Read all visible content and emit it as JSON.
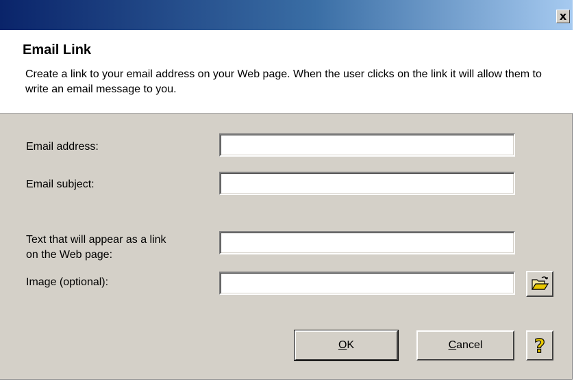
{
  "window": {
    "title": "",
    "close_glyph": "x"
  },
  "header": {
    "heading": "Email Link",
    "description": "Create a link to your email address on your Web page.  When the user clicks on the link it will allow them to write an email message to you."
  },
  "form": {
    "email_address": {
      "label": "Email address:",
      "value": ""
    },
    "email_subject": {
      "label": "Email subject:",
      "value": ""
    },
    "link_text": {
      "label_line1": "Text that will appear as a link",
      "label_line2": "on the Web page:",
      "value": ""
    },
    "image": {
      "label": "Image (optional):",
      "value": ""
    }
  },
  "buttons": {
    "ok": {
      "mnemonic": "O",
      "rest": "K"
    },
    "cancel": {
      "mnemonic": "C",
      "rest": "ancel"
    },
    "help_glyph": "?"
  },
  "icons": {
    "browse": "open-folder-icon",
    "help": "help-question-icon"
  },
  "colors": {
    "titlebar_start": "#0a246a",
    "titlebar_end": "#a6caf0",
    "dialog_bg": "#d4d0c8",
    "help_icon": "#e8c800"
  }
}
